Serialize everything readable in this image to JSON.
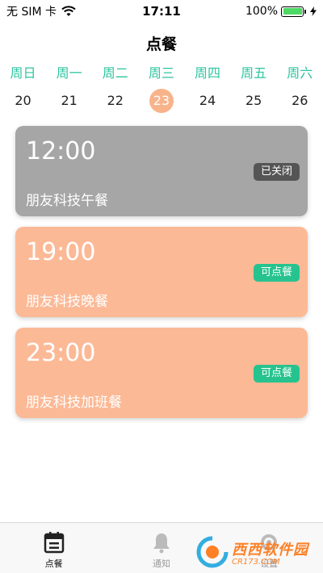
{
  "status_bar": {
    "carrier": "无 SIM 卡",
    "time": "17:11",
    "battery_percent_text": "100%",
    "battery_level": 1.0
  },
  "nav": {
    "title": "点餐"
  },
  "week": {
    "days": [
      {
        "name": "周日",
        "date": "20"
      },
      {
        "name": "周一",
        "date": "21"
      },
      {
        "name": "周二",
        "date": "22"
      },
      {
        "name": "周三",
        "date": "23",
        "selected": true
      },
      {
        "name": "周四",
        "date": "24"
      },
      {
        "name": "周五",
        "date": "25"
      },
      {
        "name": "周六",
        "date": "26"
      }
    ]
  },
  "meals": [
    {
      "time": "12:00",
      "name": "朋友科技午餐",
      "status": "已关闭",
      "state": "closed"
    },
    {
      "time": "19:00",
      "name": "朋友科技晚餐",
      "status": "可点餐",
      "state": "open"
    },
    {
      "time": "23:00",
      "name": "朋友科技加班餐",
      "status": "可点餐",
      "state": "open"
    }
  ],
  "tab_bar": {
    "tabs": [
      {
        "label": "点餐",
        "icon": "calendar-icon",
        "active": true
      },
      {
        "label": "通知",
        "icon": "bell-icon",
        "active": false
      },
      {
        "label": "设置",
        "icon": "settings-icon",
        "active": false
      }
    ]
  },
  "watermark": {
    "main": "西西软件园",
    "sub": "CR173.COM"
  },
  "colors": {
    "accent_green": "#2ec4a0",
    "selected_date": "#f9b38a",
    "closed_card": "#a6a6a6",
    "open_card": "#fcb996",
    "badge_open": "#27c38f",
    "badge_closed": "#555555"
  }
}
